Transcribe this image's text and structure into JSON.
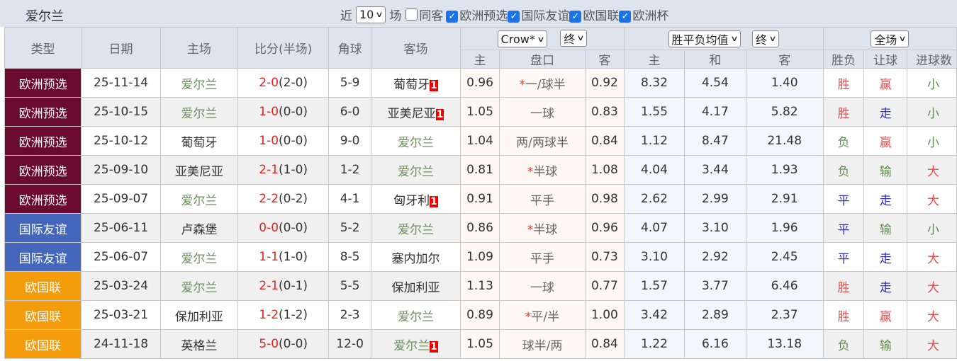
{
  "title": "爱尔兰",
  "filters": {
    "near_label": "近",
    "count": "10",
    "unit_label": "场",
    "same_label": "同客",
    "same_checked": false,
    "leagues": [
      {
        "label": "欧洲预选",
        "checked": true
      },
      {
        "label": "国际友谊",
        "checked": true
      },
      {
        "label": "欧国联",
        "checked": true
      },
      {
        "label": "欧洲杯",
        "checked": true
      }
    ]
  },
  "headers": {
    "type": "类型",
    "date": "日期",
    "home": "主场",
    "score": "比分(半场)",
    "corner": "角球",
    "away": "客场",
    "company": "Crow*",
    "odds_stage": "终",
    "euro_mode": "胜平负均值",
    "euro_stage": "终",
    "period": "全场",
    "ah_home": "主",
    "ah_line": "盘口",
    "ah_away": "客",
    "eu_home": "主",
    "eu_draw": "和",
    "eu_away": "客",
    "res": "胜负",
    "hcp": "让球",
    "ou": "进球数"
  },
  "colors": {
    "欧洲预选": "#6b0a2f",
    "国际友谊": "#4466bb",
    "欧国联": "#f59c0d",
    "win": "#f04848",
    "draw": "#3333cc",
    "lose": "#5f8f4f"
  },
  "rows": [
    {
      "type": "欧洲预选",
      "date": "25-11-14",
      "home": "爱尔兰",
      "ft": "2-0",
      "ht": "(2-0)",
      "corner": "5-9",
      "away": "葡萄牙",
      "red": "1",
      "ah_h": "0.96",
      "star": "*",
      "line": "一/球半",
      "ah_a": "0.92",
      "eh": "8.32",
      "ed": "4.54",
      "ea": "1.40",
      "res": "胜",
      "hcp": "赢",
      "ou": "小"
    },
    {
      "type": "欧洲预选",
      "date": "25-10-15",
      "home": "爱尔兰",
      "ft": "1-0",
      "ht": "(0-0)",
      "corner": "6-0",
      "away": "亚美尼亚",
      "red": "1",
      "ah_h": "1.05",
      "star": "",
      "line": "一球",
      "ah_a": "0.83",
      "eh": "1.55",
      "ed": "4.17",
      "ea": "5.82",
      "res": "胜",
      "hcp": "走",
      "ou": "小"
    },
    {
      "type": "欧洲预选",
      "date": "25-10-12",
      "home": "葡萄牙",
      "ft": "1-0",
      "ht": "(0-0)",
      "corner": "9-0",
      "away": "爱尔兰",
      "red": "",
      "ah_h": "1.04",
      "star": "",
      "line": "两/两球半",
      "ah_a": "0.84",
      "eh": "1.12",
      "ed": "8.47",
      "ea": "21.48",
      "res": "负",
      "hcp": "赢",
      "ou": "小"
    },
    {
      "type": "欧洲预选",
      "date": "25-09-10",
      "home": "亚美尼亚",
      "ft": "2-1",
      "ht": "(1-0)",
      "corner": "1-2",
      "away": "爱尔兰",
      "red": "",
      "ah_h": "0.81",
      "star": "*",
      "line": "半球",
      "ah_a": "1.08",
      "eh": "4.04",
      "ed": "3.44",
      "ea": "1.93",
      "res": "负",
      "hcp": "输",
      "ou": "大"
    },
    {
      "type": "欧洲预选",
      "date": "25-09-07",
      "home": "爱尔兰",
      "ft": "2-2",
      "ht": "(0-2)",
      "corner": "4-1",
      "away": "匈牙利",
      "red": "1",
      "ah_h": "0.91",
      "star": "",
      "line": "平手",
      "ah_a": "0.98",
      "eh": "2.62",
      "ed": "2.99",
      "ea": "2.91",
      "res": "平",
      "hcp": "走",
      "ou": "大"
    },
    {
      "type": "国际友谊",
      "date": "25-06-11",
      "home": "卢森堡",
      "ft": "0-0",
      "ht": "(0-0)",
      "corner": "5-2",
      "away": "爱尔兰",
      "red": "",
      "ah_h": "0.86",
      "star": "*",
      "line": "半球",
      "ah_a": "0.96",
      "eh": "4.07",
      "ed": "3.10",
      "ea": "1.96",
      "res": "平",
      "hcp": "输",
      "ou": "小"
    },
    {
      "type": "国际友谊",
      "date": "25-06-07",
      "home": "爱尔兰",
      "ft": "1-1",
      "ht": "(1-0)",
      "corner": "8-5",
      "away": "塞内加尔",
      "red": "",
      "ah_h": "1.09",
      "star": "",
      "line": "平手",
      "ah_a": "0.73",
      "eh": "3.10",
      "ed": "2.92",
      "ea": "2.45",
      "res": "平",
      "hcp": "走",
      "ou": "大"
    },
    {
      "type": "欧国联",
      "date": "25-03-24",
      "home": "爱尔兰",
      "ft": "2-1",
      "ht": "(0-1)",
      "corner": "5-5",
      "away": "保加利亚",
      "red": "",
      "ah_h": "1.13",
      "star": "",
      "line": "一球",
      "ah_a": "0.77",
      "eh": "1.57",
      "ed": "3.77",
      "ea": "6.46",
      "res": "胜",
      "hcp": "走",
      "ou": "大"
    },
    {
      "type": "欧国联",
      "date": "25-03-21",
      "home": "保加利亚",
      "ft": "1-2",
      "ht": "(1-2)",
      "corner": "2-3",
      "away": "爱尔兰",
      "red": "",
      "ah_h": "0.89",
      "star": "*",
      "line": "平/半",
      "ah_a": "1.00",
      "eh": "3.42",
      "ed": "2.89",
      "ea": "2.37",
      "res": "胜",
      "hcp": "赢",
      "ou": "大"
    },
    {
      "type": "欧国联",
      "date": "24-11-18",
      "home": "英格兰",
      "ft": "5-0",
      "ht": "(0-0)",
      "corner": "12-0",
      "away": "爱尔兰",
      "red": "1",
      "ah_h": "1.05",
      "star": "",
      "line": "球半/两",
      "ah_a": "0.84",
      "eh": "1.22",
      "ed": "6.16",
      "ea": "13.18",
      "res": "负",
      "hcp": "输",
      "ou": "大"
    }
  ]
}
